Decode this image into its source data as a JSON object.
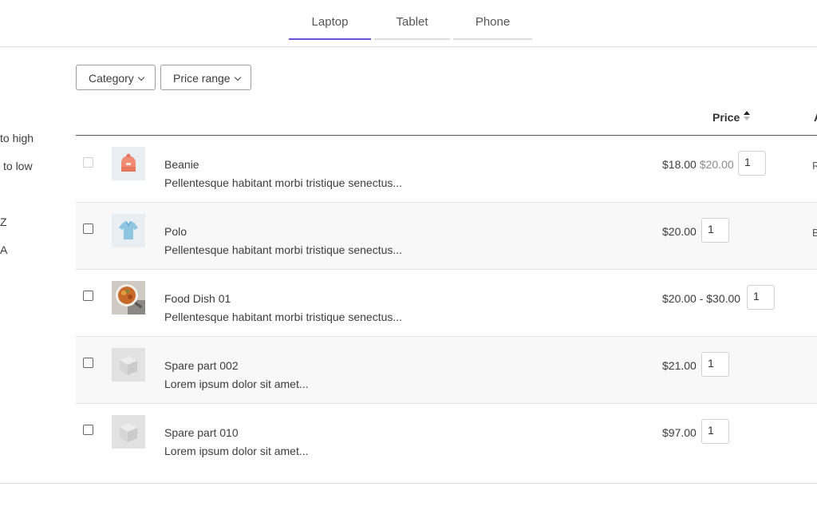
{
  "tabs": [
    {
      "label": "Laptop",
      "active": true
    },
    {
      "label": "Tablet",
      "active": false
    },
    {
      "label": "Phone",
      "active": false
    }
  ],
  "sort_options": [
    "to high",
    "to low",
    "Z",
    "A"
  ],
  "filters": {
    "category": "Category",
    "price_range": "Price range"
  },
  "table": {
    "price_header": "Price",
    "edge_header": "A",
    "rows": [
      {
        "name": "Beanie",
        "desc": "Pellentesque habitant morbi tristique senectus...",
        "price": "$18.00",
        "old_price": "$20.00",
        "qty": "1",
        "edge": "R",
        "checkbox_disabled": true
      },
      {
        "name": "Polo",
        "desc": "Pellentesque habitant morbi tristique senectus...",
        "price": "$20.00",
        "qty": "1",
        "edge": "B"
      },
      {
        "name": "Food Dish 01",
        "desc": "Pellentesque habitant morbi tristique senectus...",
        "price": "$20.00 - $30.00",
        "qty": "1"
      },
      {
        "name": "Spare part 002",
        "desc": "Lorem ipsum dolor sit amet...",
        "price": "$21.00",
        "qty": "1"
      },
      {
        "name": "Spare part 010",
        "desc": "Lorem ipsum dolor sit amet...",
        "price": "$97.00",
        "qty": "1"
      }
    ]
  },
  "colors": {
    "accent": "#6c4ed6",
    "stripe": "#f8f8f8"
  },
  "icons": {
    "beanie": "beanie-thumbnail",
    "polo": "polo-shirt-thumbnail",
    "food": "food-dish-thumbnail",
    "placeholder": "placeholder-cube-thumbnail",
    "sort": "sort-arrows-icon",
    "chevron": "chevron-down-icon"
  }
}
